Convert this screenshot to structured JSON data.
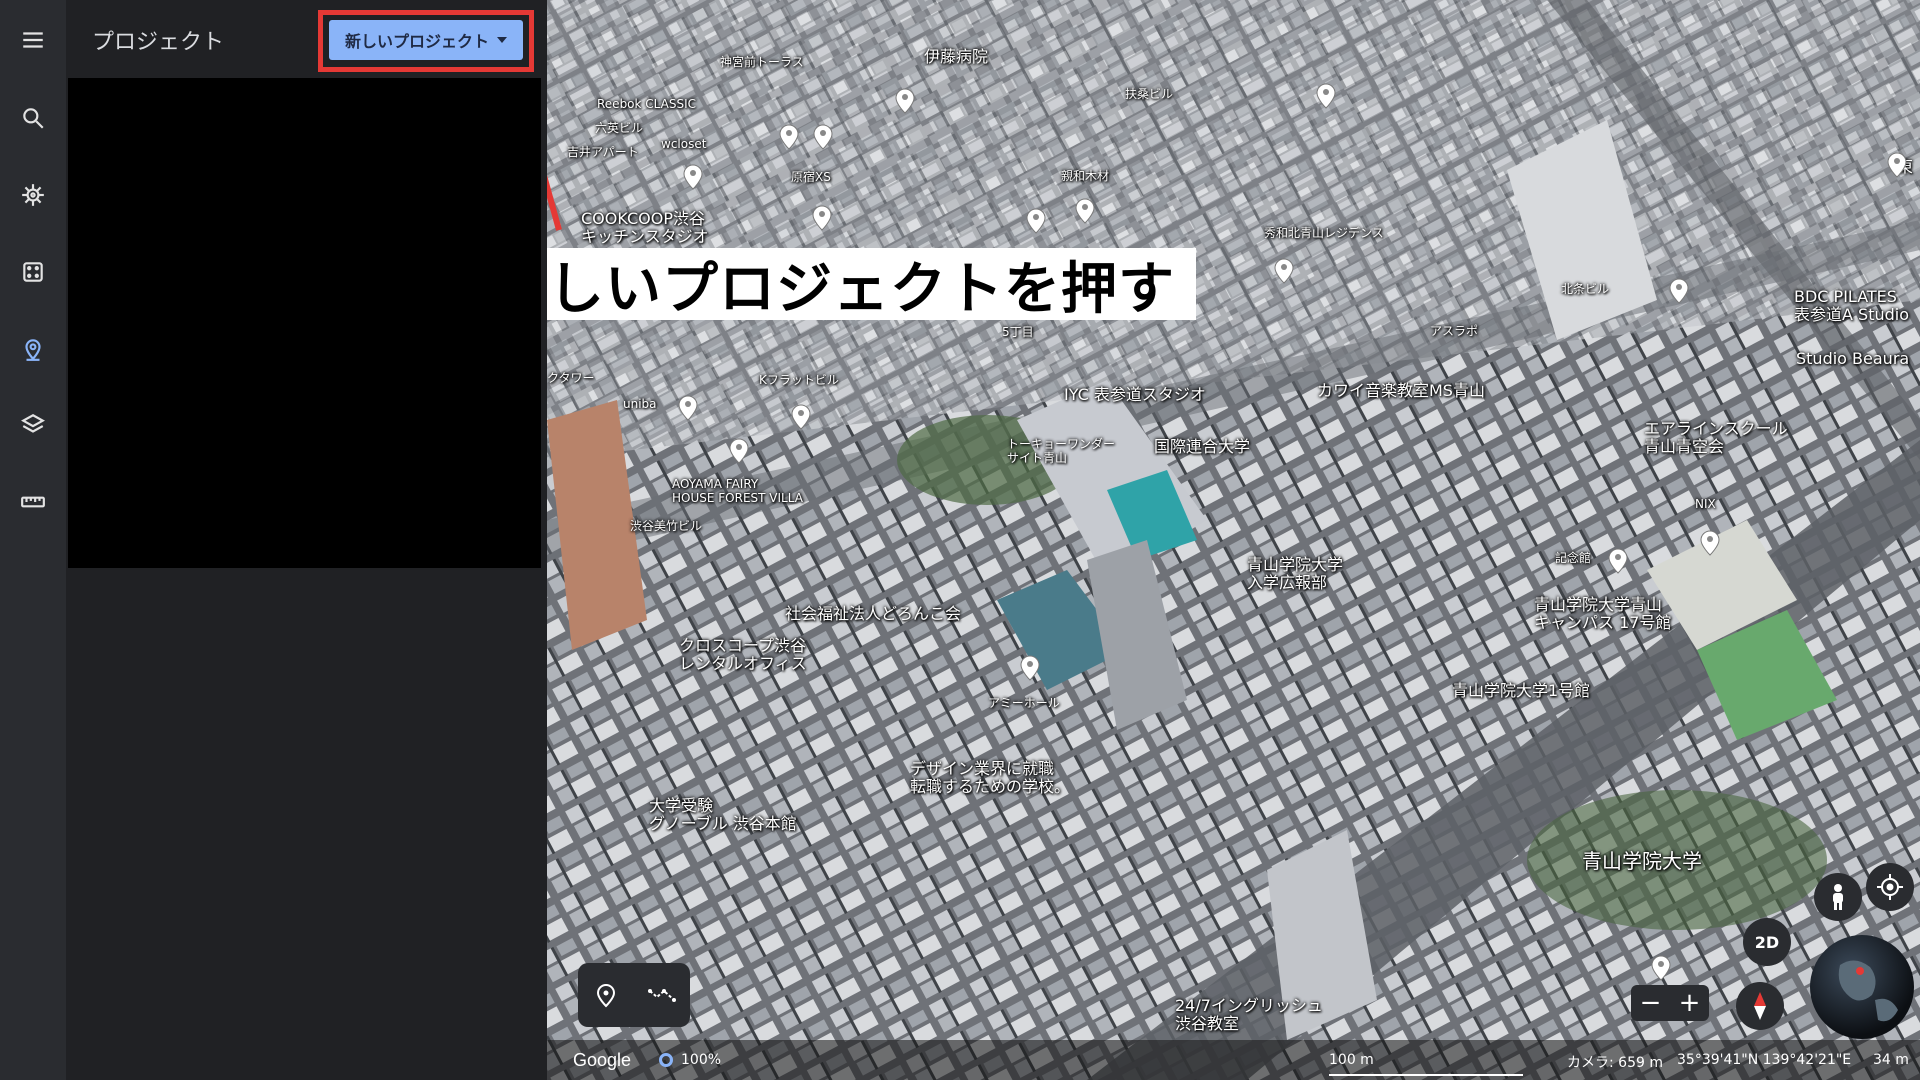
{
  "rail": {
    "items": [
      {
        "name": "menu-icon"
      },
      {
        "name": "search-icon"
      },
      {
        "name": "voyager-icon"
      },
      {
        "name": "feeling-lucky-icon"
      },
      {
        "name": "projects-icon"
      },
      {
        "name": "map-style-icon"
      },
      {
        "name": "measure-icon"
      }
    ],
    "active_color": "#8ab4f8"
  },
  "panel": {
    "title": "プロジェクト",
    "new_project_label": "新しいプロジェクト"
  },
  "annotation": {
    "text": "新しいプロジェクトを押す",
    "highlight_color": "#e53935"
  },
  "map": {
    "labels": [
      {
        "text": "伊藤病院"
      },
      {
        "text": "神宮前トーラス"
      },
      {
        "text": "Reebok CLASSIC"
      },
      {
        "text": "扶桑ビル"
      },
      {
        "text": "六英ビル"
      },
      {
        "text": "吉井アパート"
      },
      {
        "text": "wcloset"
      },
      {
        "text": "原宿XS"
      },
      {
        "text": "親和木材"
      },
      {
        "text": "COOKCOOP渋谷\nキッチンスタジオ"
      },
      {
        "text": "秀和北青山レジデンス"
      },
      {
        "text": "北条ビル"
      },
      {
        "text": "BDC PILATES\n表参道A Studio"
      },
      {
        "text": "Studio Beaura"
      },
      {
        "text": "5丁目"
      },
      {
        "text": "アスラポ"
      },
      {
        "text": "クタワー"
      },
      {
        "text": "Kフラットビル"
      },
      {
        "text": "IYC 表参道スタジオ"
      },
      {
        "text": "カワイ音楽教室MS青山"
      },
      {
        "text": "uniba"
      },
      {
        "text": "エアラインスクール\n青山青空会"
      },
      {
        "text": "トーキョーワンダー\nサイト青山"
      },
      {
        "text": "国際連合大学"
      },
      {
        "text": "AOYAMA FAIRY\nHOUSE FOREST VILLA"
      },
      {
        "text": "NIX"
      },
      {
        "text": "渋谷美竹ビル"
      },
      {
        "text": "記念館"
      },
      {
        "text": "青山学院大学\n入学広報部"
      },
      {
        "text": "社会福祉法人どろんこ会"
      },
      {
        "text": "青山学院大学青山\nキャンパス 17号館"
      },
      {
        "text": "クロスコープ渋谷\nレンタルオフィス"
      },
      {
        "text": "青山学院大学1号館"
      },
      {
        "text": "アミーホール"
      },
      {
        "text": "デザイン業界に就職\n転職するための学校。"
      },
      {
        "text": "大学受験\nグノーブル 渋谷本館"
      },
      {
        "text": "青山学院大学"
      },
      {
        "text": "24/7イングリッシュ\n渋谷教室"
      },
      {
        "text": "東"
      }
    ]
  },
  "controls": {
    "mode_2d_label": "2D",
    "zoom_out_label": "−",
    "zoom_in_label": "+"
  },
  "status": {
    "google_label": "Google",
    "loading_percent": "100%",
    "scale_label": "100 m",
    "camera_label": "カメラ: 659 m",
    "coordinates": "35°39'41\"N 139°42'21\"E",
    "altitude": "34 m"
  }
}
